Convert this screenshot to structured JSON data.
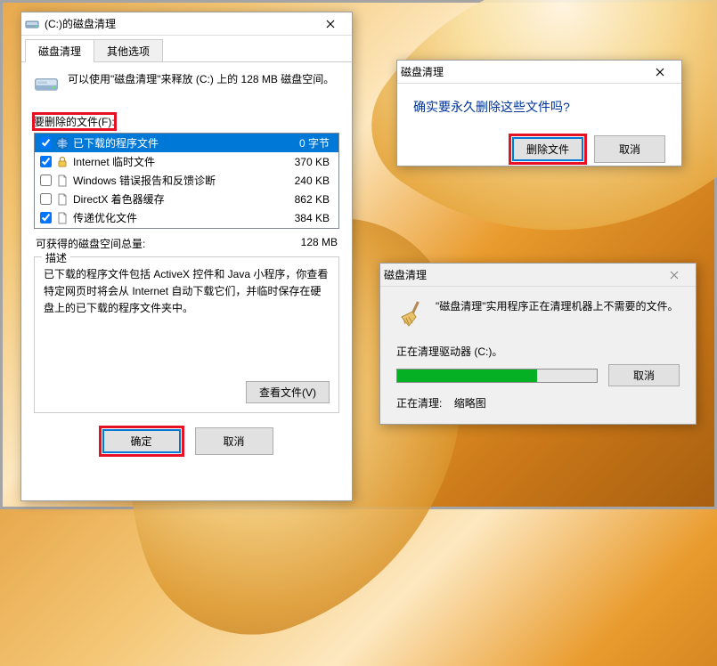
{
  "main": {
    "title": "(C:)的磁盘清理",
    "tabs": [
      {
        "label": "磁盘清理"
      },
      {
        "label": "其他选项"
      }
    ],
    "info": "可以使用\"磁盘清理\"来释放  (C:) 上的 128 MB 磁盘空间。",
    "section_label": "要删除的文件(F):",
    "files": [
      {
        "label": "已下载的程序文件",
        "size": "0 字节",
        "checked": true,
        "selected": true,
        "icon": "globe"
      },
      {
        "label": "Internet 临时文件",
        "size": "370 KB",
        "checked": true,
        "selected": false,
        "icon": "lock"
      },
      {
        "label": "Windows 错误报告和反馈诊断",
        "size": "240 KB",
        "checked": false,
        "selected": false,
        "icon": "file"
      },
      {
        "label": "DirectX 着色器缓存",
        "size": "862 KB",
        "checked": false,
        "selected": false,
        "icon": "file"
      },
      {
        "label": "传递优化文件",
        "size": "384 KB",
        "checked": true,
        "selected": false,
        "icon": "file"
      }
    ],
    "total_label": "可获得的磁盘空间总量:",
    "total_value": "128 MB",
    "desc_legend": "描述",
    "desc_text": "已下载的程序文件包括 ActiveX 控件和 Java 小程序，你查看特定网页时将会从 Internet 自动下载它们，并临时保存在硬盘上的已下载的程序文件夹中。",
    "view_files_btn": "查看文件(V)",
    "ok_btn": "确定",
    "cancel_btn": "取消"
  },
  "confirm": {
    "title": "磁盘清理",
    "question": "确实要永久删除这些文件吗?",
    "delete_btn": "删除文件",
    "cancel_btn": "取消"
  },
  "progress": {
    "title": "磁盘清理",
    "message": "\"磁盘清理\"实用程序正在清理机器上不需要的文件。",
    "cleaning_label": "正在清理驱动器  (C:)。",
    "percent": 70,
    "status_prefix": "正在清理:",
    "status_item": "缩略图",
    "cancel_btn": "取消"
  }
}
